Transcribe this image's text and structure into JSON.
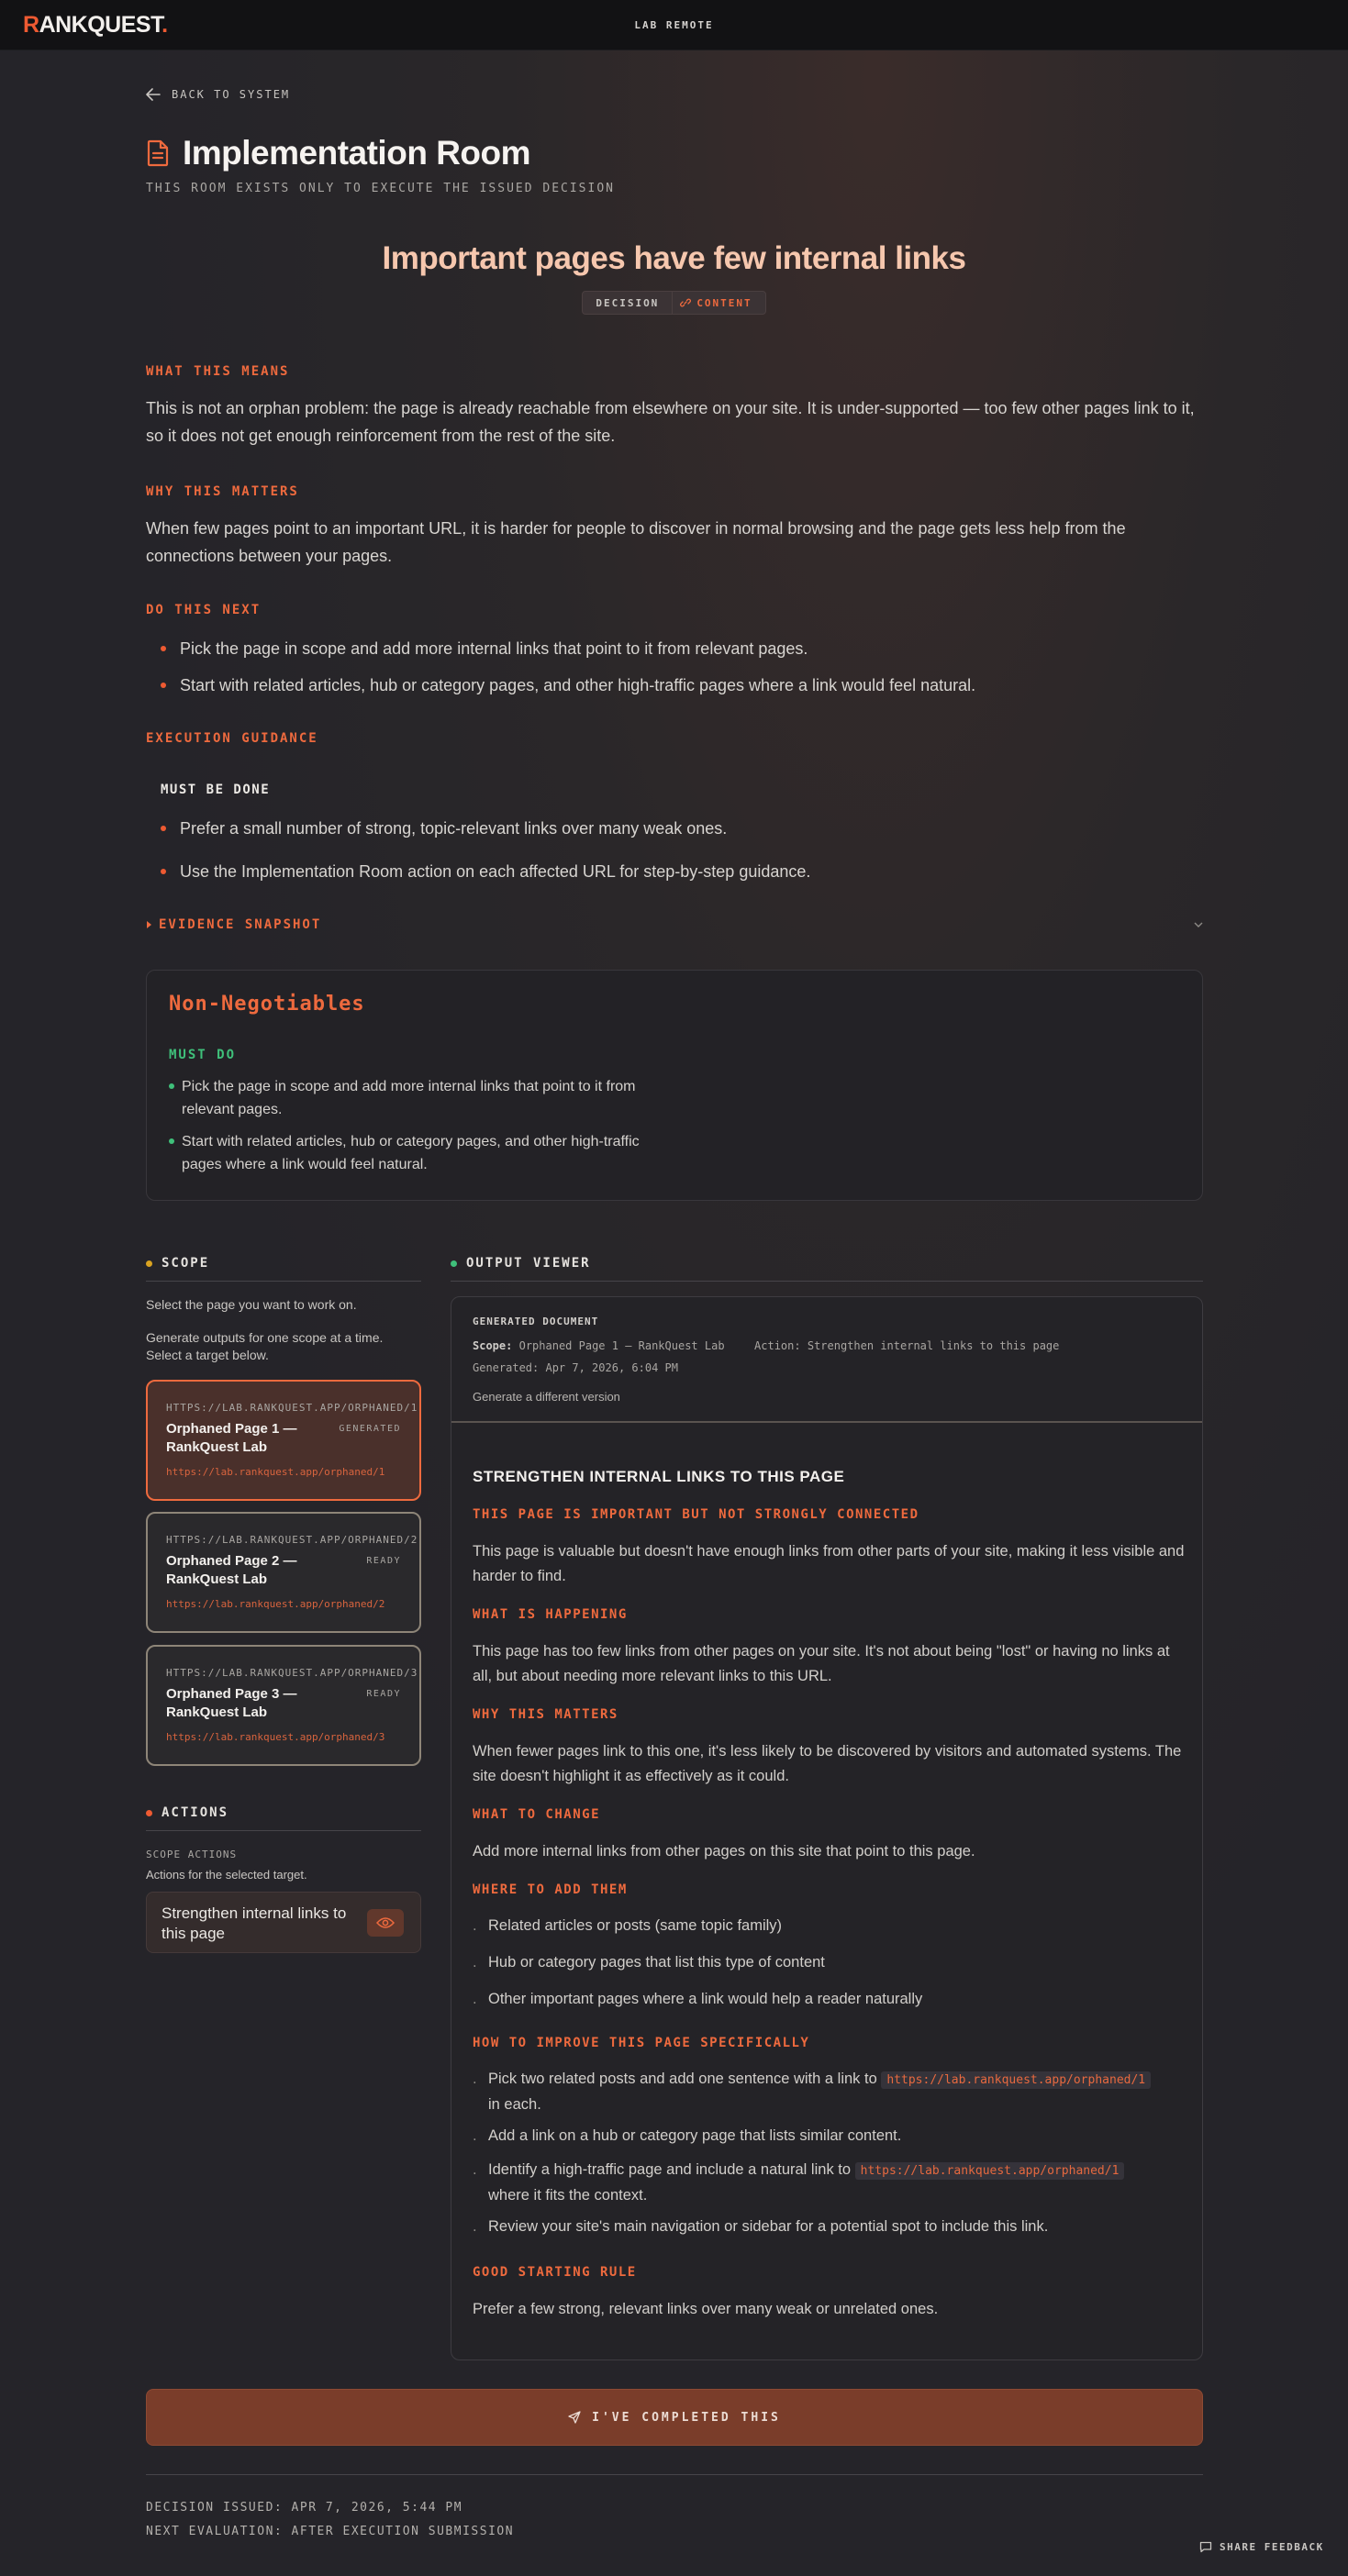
{
  "app": {
    "logo_first": "R",
    "logo_rest": "ANKQUEST",
    "logo_dot": ".",
    "env": "LAB REMOTE"
  },
  "nav": {
    "back_label": "BACK TO SYSTEM"
  },
  "room": {
    "title": "Implementation Room",
    "subtitle": "THIS ROOM EXISTS ONLY TO EXECUTE THE ISSUED DECISION"
  },
  "decision": {
    "headline": "Important pages have few internal links",
    "badge_type": "DECISION",
    "badge_category": "CONTENT"
  },
  "sections": {
    "what_label": "WHAT THIS MEANS",
    "what_text": "This is not an orphan problem: the page is already reachable from elsewhere on your site. It is under-supported — too few other pages link to it, so it does not get enough reinforcement from the rest of the site.",
    "why_label": "WHY THIS MATTERS",
    "why_text": "When few pages point to an important URL, it is harder for people to discover in normal browsing and the page gets less help from the connections between your pages.",
    "next_label": "DO THIS NEXT",
    "next_items": [
      "Pick the page in scope and add more internal links that point to it from relevant pages.",
      "Start with related articles, hub or category pages, and other high-traffic pages where a link would feel natural."
    ],
    "guidance_label": "EXECUTION GUIDANCE",
    "guidance_must": "MUST BE DONE",
    "guidance_items": [
      "Prefer a small number of strong, topic-relevant links over many weak ones.",
      "Use the Implementation Room action on each affected URL for step-by-step guidance."
    ],
    "evidence_label": "EVIDENCE SNAPSHOT"
  },
  "non_negotiables": {
    "title": "Non-Negotiables",
    "must_label": "MUST DO",
    "items": [
      "Pick the page in scope and add more internal links that point to it from relevant pages.",
      "Start with related articles, hub or category pages, and other high-traffic pages where a link would feel natural."
    ]
  },
  "scope": {
    "label": "SCOPE",
    "intro": "Select the page you want to work on.",
    "hint": "Generate outputs for one scope at a time. Select a target below.",
    "items": [
      {
        "url": "HTTPS://LAB.RANKQUEST.APP/ORPHANED/1",
        "name": "Orphaned Page 1 — RankQuest Lab",
        "status": "GENERATED",
        "link": "https://lab.rankquest.app/orphaned/1"
      },
      {
        "url": "HTTPS://LAB.RANKQUEST.APP/ORPHANED/2",
        "name": "Orphaned Page 2 — RankQuest Lab",
        "status": "READY",
        "link": "https://lab.rankquest.app/orphaned/2"
      },
      {
        "url": "HTTPS://LAB.RANKQUEST.APP/ORPHANED/3",
        "name": "Orphaned Page 3 — RankQuest Lab",
        "status": "READY",
        "link": "https://lab.rankquest.app/orphaned/3"
      }
    ]
  },
  "actions": {
    "label": "ACTIONS",
    "sub_label": "SCOPE ACTIONS",
    "hint": "Actions for the selected target.",
    "button": "Strengthen internal links to this page"
  },
  "output": {
    "label": "OUTPUT VIEWER",
    "doc_label": "GENERATED DOCUMENT",
    "scope_key": "Scope:",
    "scope_value": "Orphaned Page 1 — RankQuest Lab",
    "action_key": "Action:",
    "action_value": "Strengthen internal links to this page",
    "generated": "Generated: Apr 7, 2026, 6:04 PM",
    "regen": "Generate a different version",
    "doc": {
      "title": "STRENGTHEN INTERNAL LINKS TO THIS PAGE",
      "h1": "THIS PAGE IS IMPORTANT BUT NOT STRONGLY CONNECTED",
      "p1": "This page is valuable but doesn't have enough links from other parts of your site, making it less visible and harder to find.",
      "h2": "WHAT IS HAPPENING",
      "p2": "This page has too few links from other pages on your site. It's not about being \"lost\" or having no links at all, but about needing more relevant links to this URL.",
      "h3": "WHY THIS MATTERS",
      "p3": "When fewer pages link to this one, it's less likely to be discovered by visitors and automated systems. The site doesn't highlight it as effectively as it could.",
      "h4": "WHAT TO CHANGE",
      "p4": "Add more internal links from other pages on this site that point to this page.",
      "h5": "WHERE TO ADD THEM",
      "where": [
        "Related articles or posts (same topic family)",
        "Hub or category pages that list this type of content",
        "Other important pages where a link would help a reader naturally"
      ],
      "h6": "HOW TO IMPROVE THIS PAGE SPECIFICALLY",
      "how1_a": "Pick two related posts and add one sentence with a link to",
      "how1_code": "https://lab.rankquest.app/orphaned/1",
      "how1_b": "in each.",
      "how2": "Add a link on a hub or category page that lists similar content.",
      "how3_a": "Identify a high-traffic page and include a natural link to",
      "how3_code": "https://lab.rankquest.app/orphaned/1",
      "how3_b": "where it fits the context.",
      "how4": "Review your site's main navigation or sidebar for a potential spot to include this link.",
      "h7": "GOOD STARTING RULE",
      "p7": "Prefer a few strong, relevant links over many weak or unrelated ones."
    }
  },
  "complete_button": "I'VE COMPLETED THIS",
  "footer": {
    "issued": "DECISION ISSUED: APR 7, 2026, 5:44 PM",
    "next_eval": "NEXT EVALUATION: AFTER EXECUTION SUBMISSION",
    "feedback": "SHARE FEEDBACK"
  }
}
